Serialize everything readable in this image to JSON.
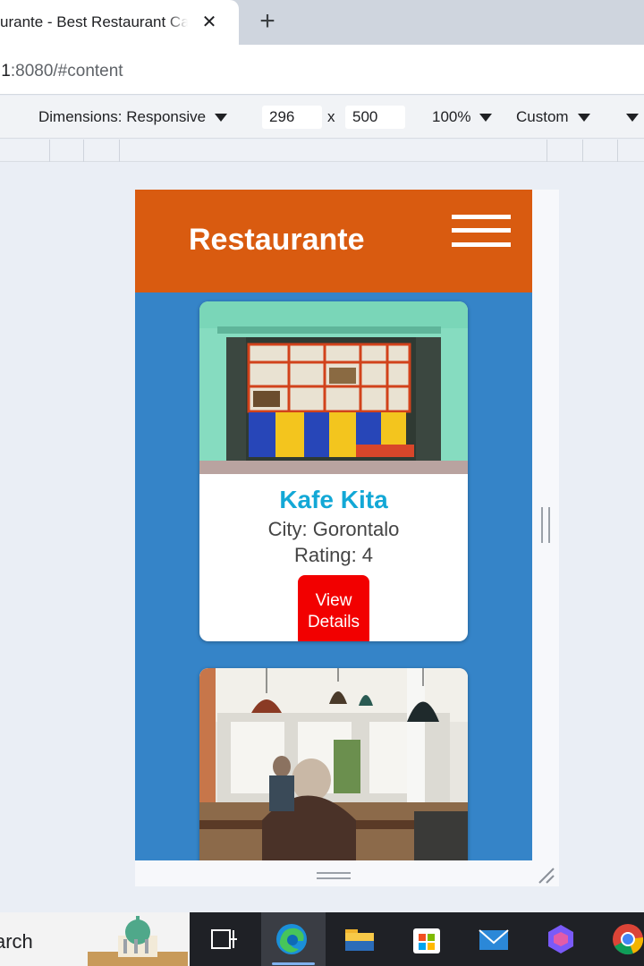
{
  "browser": {
    "tab_title": "urante - Best Restaurant Catalog",
    "tab_close": "✕",
    "new_tab": "+",
    "url_host": ".1",
    "url_rest": ":8080/#content"
  },
  "devtools": {
    "dimensions_label": "Dimensions: Responsive",
    "width_value": "296",
    "times": "x",
    "height_value": "500",
    "zoom": "100%",
    "throttle": "Custom"
  },
  "app": {
    "title": "Restaurante",
    "restaurants": [
      {
        "name": "Kafe Kita",
        "city": "City: Gorontalo",
        "rating": "Rating: 4",
        "button_label": "View Details"
      },
      {
        "name": "",
        "city": "",
        "rating": ""
      }
    ]
  },
  "taskbar": {
    "search_text": "arch"
  },
  "colors": {
    "header": "#d95b10",
    "page_bg": "#3584c8",
    "name_accent": "#13a8d6",
    "button": "#f20000"
  }
}
